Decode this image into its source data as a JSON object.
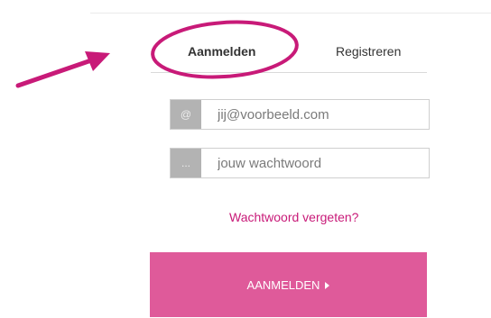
{
  "tabs": {
    "login_label": "Aanmelden",
    "register_label": "Registreren"
  },
  "login_form": {
    "email_prefix": "@",
    "email_placeholder": "jij@voorbeeld.com",
    "password_prefix": "...",
    "password_placeholder": "jouw wachtwoord",
    "forgot_link": "Wachtwoord vergeten?",
    "submit_label": "AANMELDEN"
  },
  "annotations": {
    "highlight_color": "#c81a78",
    "arrow_color": "#c81a78"
  },
  "colors": {
    "brand_pink": "#df5a9a",
    "link_pink": "#c81a78",
    "prefix_gray": "#b3b3b3"
  }
}
